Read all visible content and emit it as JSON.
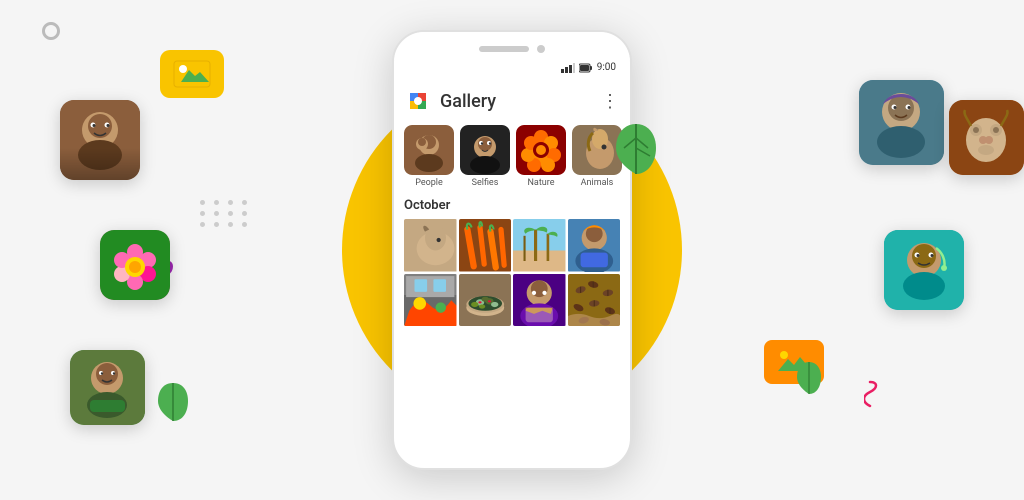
{
  "app": {
    "title": "Gallery",
    "time": "9:00",
    "section_title": "October"
  },
  "categories": [
    {
      "id": "people",
      "label": "People",
      "color_class": "cat-people-inner"
    },
    {
      "id": "selfies",
      "label": "Selfies",
      "color_class": "cat-selfies-inner"
    },
    {
      "id": "nature",
      "label": "Nature",
      "color_class": "cat-nature-inner"
    },
    {
      "id": "animals",
      "label": "Animals",
      "color_class": "cat-animals-inner"
    }
  ],
  "decorative": {
    "dots_label": "decorative dots pattern",
    "leaf_label": "green leaf",
    "photo_icon_label": "photo frame icon",
    "squiggle_label": "decorative squiggle"
  },
  "colors": {
    "accent_yellow": "#F9C400",
    "background": "#f5f5f5",
    "phone_bg": "#ffffff",
    "leaf_green": "#4CAF50"
  }
}
